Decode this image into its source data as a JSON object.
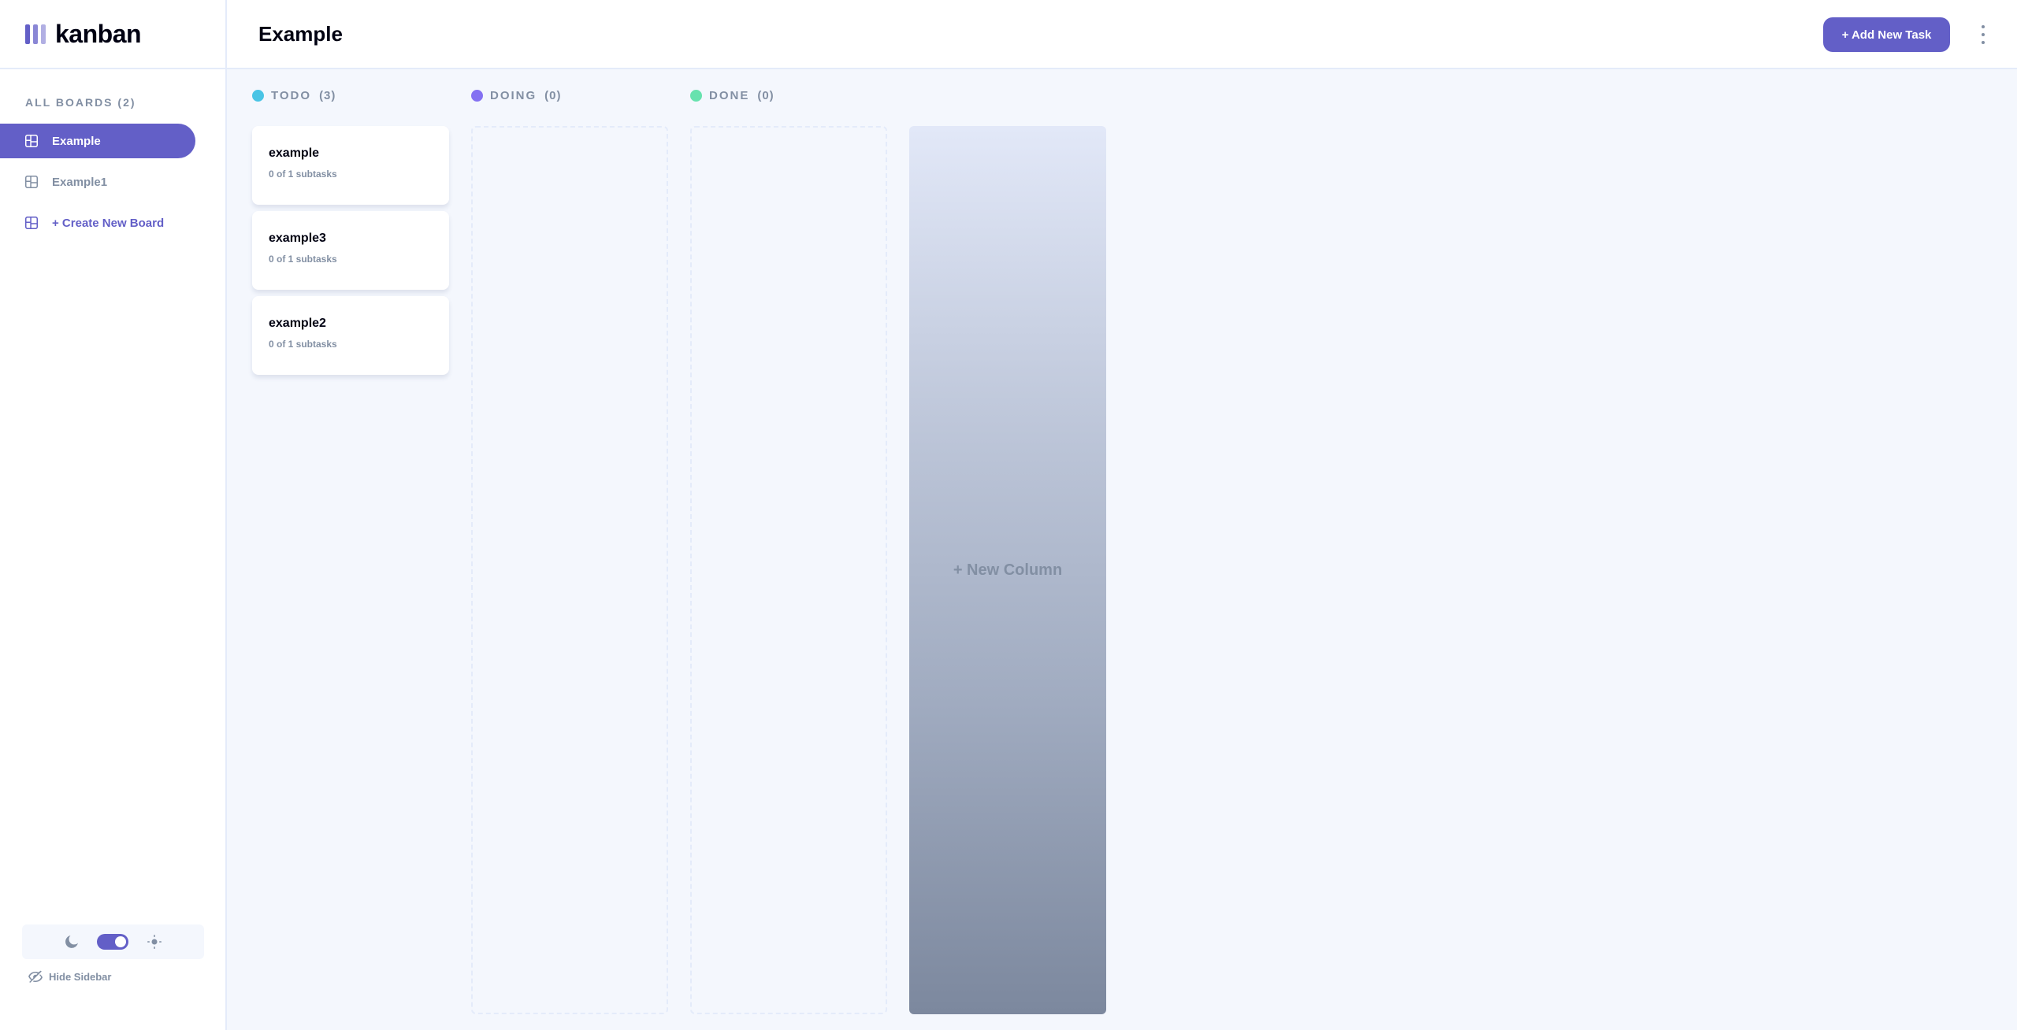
{
  "app": {
    "logo_text": "kanban"
  },
  "sidebar": {
    "boards_heading": "ALL BOARDS (2)",
    "boards": [
      {
        "label": "Example",
        "active": true
      },
      {
        "label": "Example1",
        "active": false
      }
    ],
    "create_label": "+ Create New Board",
    "hide_sidebar_label": "Hide Sidebar"
  },
  "header": {
    "title": "Example",
    "add_task_label": "+ Add New Task"
  },
  "columns": [
    {
      "name": "TODO",
      "count": "(3)",
      "color": "#49c4e5",
      "tasks": [
        {
          "title": "example",
          "subtasks": "0 of 1 subtasks"
        },
        {
          "title": "example3",
          "subtasks": "0 of 1 subtasks"
        },
        {
          "title": "example2",
          "subtasks": "0 of 1 subtasks"
        }
      ]
    },
    {
      "name": "DOING",
      "count": "(0)",
      "color": "#8471f2",
      "tasks": []
    },
    {
      "name": "DONE",
      "count": "(0)",
      "color": "#67e2ae",
      "tasks": []
    }
  ],
  "new_column_label": "+ New Column",
  "colors": {
    "accent": "#635fc7",
    "background": "#f4f7fd",
    "text_muted": "#828fa3"
  }
}
